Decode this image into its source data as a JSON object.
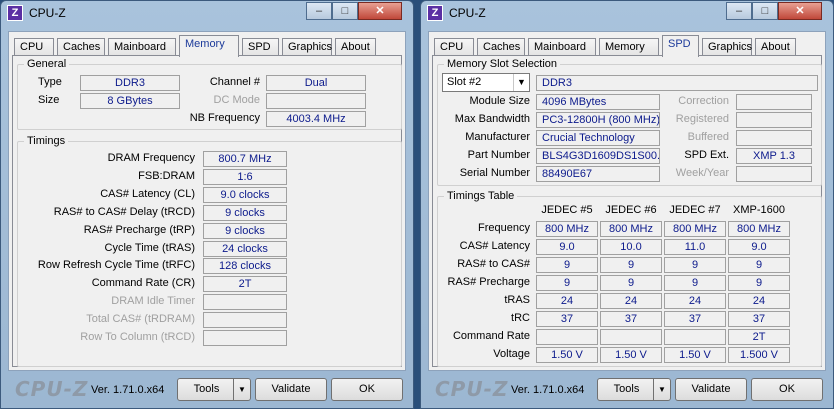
{
  "app": {
    "title": "CPU-Z",
    "logo": "CPU-Z",
    "icon_letter": "Z",
    "version": "Ver. 1.71.0.x64"
  },
  "buttons": {
    "tools": "Tools",
    "validate": "Validate",
    "ok": "OK",
    "dropdown_glyph": "▼"
  },
  "window_controls": {
    "minimize": "–",
    "maximize": "□",
    "close": "✕"
  },
  "tabs": [
    "CPU",
    "Caches",
    "Mainboard",
    "Memory",
    "SPD",
    "Graphics",
    "About"
  ],
  "memory": {
    "general_legend": "General",
    "type_label": "Type",
    "type": "DDR3",
    "size_label": "Size",
    "size": "8 GBytes",
    "channel_label": "Channel #",
    "channel": "Dual",
    "dc_mode_label": "DC Mode",
    "dc_mode": "",
    "nb_freq_label": "NB Frequency",
    "nb_freq": "4003.4 MHz",
    "timings_legend": "Timings",
    "timings": [
      {
        "label": "DRAM Frequency",
        "value": "800.7 MHz",
        "disabled": false
      },
      {
        "label": "FSB:DRAM",
        "value": "1:6",
        "disabled": false
      },
      {
        "label": "CAS# Latency (CL)",
        "value": "9.0 clocks",
        "disabled": false
      },
      {
        "label": "RAS# to CAS# Delay (tRCD)",
        "value": "9 clocks",
        "disabled": false
      },
      {
        "label": "RAS# Precharge (tRP)",
        "value": "9 clocks",
        "disabled": false
      },
      {
        "label": "Cycle Time (tRAS)",
        "value": "24 clocks",
        "disabled": false
      },
      {
        "label": "Row Refresh Cycle Time (tRFC)",
        "value": "128 clocks",
        "disabled": false
      },
      {
        "label": "Command Rate (CR)",
        "value": "2T",
        "disabled": false
      },
      {
        "label": "DRAM Idle Timer",
        "value": "",
        "disabled": true
      },
      {
        "label": "Total CAS# (tRDRAM)",
        "value": "",
        "disabled": true
      },
      {
        "label": "Row To Column (tRCD)",
        "value": "",
        "disabled": true
      }
    ]
  },
  "spd": {
    "slot_legend": "Memory Slot Selection",
    "slot": "Slot #2",
    "type": "DDR3",
    "left_rows": [
      {
        "label": "Module Size",
        "value": "4096 MBytes"
      },
      {
        "label": "Max Bandwidth",
        "value": "PC3-12800H (800 MHz)"
      },
      {
        "label": "Manufacturer",
        "value": "Crucial Technology"
      },
      {
        "label": "Part Number",
        "value": "BLS4G3D1609DS1S00."
      },
      {
        "label": "Serial Number",
        "value": "88490E67"
      }
    ],
    "right_rows": [
      {
        "label": "Correction",
        "value": "",
        "disabled": true
      },
      {
        "label": "Registered",
        "value": "",
        "disabled": true
      },
      {
        "label": "Buffered",
        "value": "",
        "disabled": true
      },
      {
        "label": "SPD Ext.",
        "value": "XMP 1.3",
        "disabled": false
      },
      {
        "label": "Week/Year",
        "value": "",
        "disabled": true
      }
    ],
    "timings_legend": "Timings Table",
    "columns": [
      "JEDEC #5",
      "JEDEC #6",
      "JEDEC #7",
      "XMP-1600"
    ],
    "rows": [
      {
        "label": "Frequency",
        "values": [
          "800 MHz",
          "800 MHz",
          "800 MHz",
          "800 MHz"
        ]
      },
      {
        "label": "CAS# Latency",
        "values": [
          "9.0",
          "10.0",
          "11.0",
          "9.0"
        ]
      },
      {
        "label": "RAS# to CAS#",
        "values": [
          "9",
          "9",
          "9",
          "9"
        ]
      },
      {
        "label": "RAS# Precharge",
        "values": [
          "9",
          "9",
          "9",
          "9"
        ]
      },
      {
        "label": "tRAS",
        "values": [
          "24",
          "24",
          "24",
          "24"
        ]
      },
      {
        "label": "tRC",
        "values": [
          "37",
          "37",
          "37",
          "37"
        ]
      },
      {
        "label": "Command Rate",
        "values": [
          "",
          "",
          "",
          "2T"
        ]
      },
      {
        "label": "Voltage",
        "values": [
          "1.50 V",
          "1.50 V",
          "1.50 V",
          "1.500 V"
        ]
      }
    ]
  }
}
